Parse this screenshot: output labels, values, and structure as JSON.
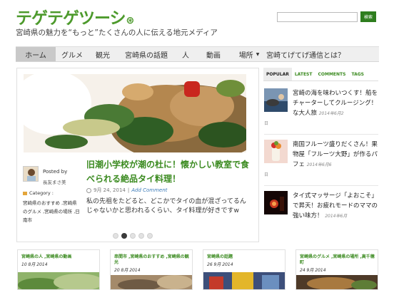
{
  "site": {
    "logo": "テゲテゲツーシ",
    "tagline": "宮崎県の魅力を“もっと”たくさんの人に伝える地元メディア"
  },
  "search": {
    "value": "",
    "placeholder": "",
    "button": "検索"
  },
  "nav": {
    "items": [
      {
        "label": "ホーム",
        "active": true
      },
      {
        "label": "グルメ"
      },
      {
        "label": "観光"
      },
      {
        "label": "宮崎県の話題"
      },
      {
        "label": "人"
      },
      {
        "label": "動画"
      },
      {
        "label": "場所",
        "has_dropdown": true
      },
      {
        "label": "宮崎てげてげ通信とは？"
      }
    ]
  },
  "featured": {
    "posted_by": "Posted by",
    "author": "長友まさ美",
    "category_label": "Category :",
    "categories": "宮崎県のおすすめ ,宮崎県のグルメ ,宮崎県の場所 ,日南市",
    "title": "旧潮小学校が潮の杜に！懐かしい教室で食べられる絶品タイ料理！",
    "date": "9月 24, 2014",
    "separator": "|",
    "comment_link": "Add Comment",
    "excerpt": "私の先祖をたどると、どこかでタイの血が混ざってるんじゃないかと思われるくらい、タイ料理が好きですw"
  },
  "slider": {
    "count": 5,
    "active_index": 1
  },
  "sidebar": {
    "tabs": [
      {
        "label": "POPULAR",
        "active": true
      },
      {
        "label": "LATEST"
      },
      {
        "label": "COMMENTS"
      },
      {
        "label": "TAGS"
      }
    ],
    "popular": [
      {
        "title": "宮崎の海を味わいつくす！船をチャーターしてクルージング！な大人旅",
        "date": "2014年6月2",
        "extra": "日"
      },
      {
        "title": "南国フルーツ盛りだくさん！果物屋「フルーツ大野」が作るパフェ",
        "date": "2014年6月6",
        "extra": "日"
      },
      {
        "title": "タイ式マッサージ「よおこそ」で昇天！お疲れモードのママの強い味方！",
        "date": "2014年6月",
        "extra": ""
      }
    ]
  },
  "cards": [
    {
      "category": "宮崎県の人 ,宮崎県の動画",
      "date": "10 8月 2014"
    },
    {
      "category": "串間市 ,宮崎県のおすすめ ,宮崎県の観光",
      "date": "20 8月 2014"
    },
    {
      "category": "宮崎県の話題",
      "date": "26 9月 2014"
    },
    {
      "category": "宮崎県のグルメ ,宮崎県の場所 ,高千穂町",
      "date": "24 9月 2014"
    }
  ],
  "colors": {
    "brand_green": "#4d9a2c",
    "nav_bg": "#efefef",
    "button_green": "#2e7d1e"
  }
}
